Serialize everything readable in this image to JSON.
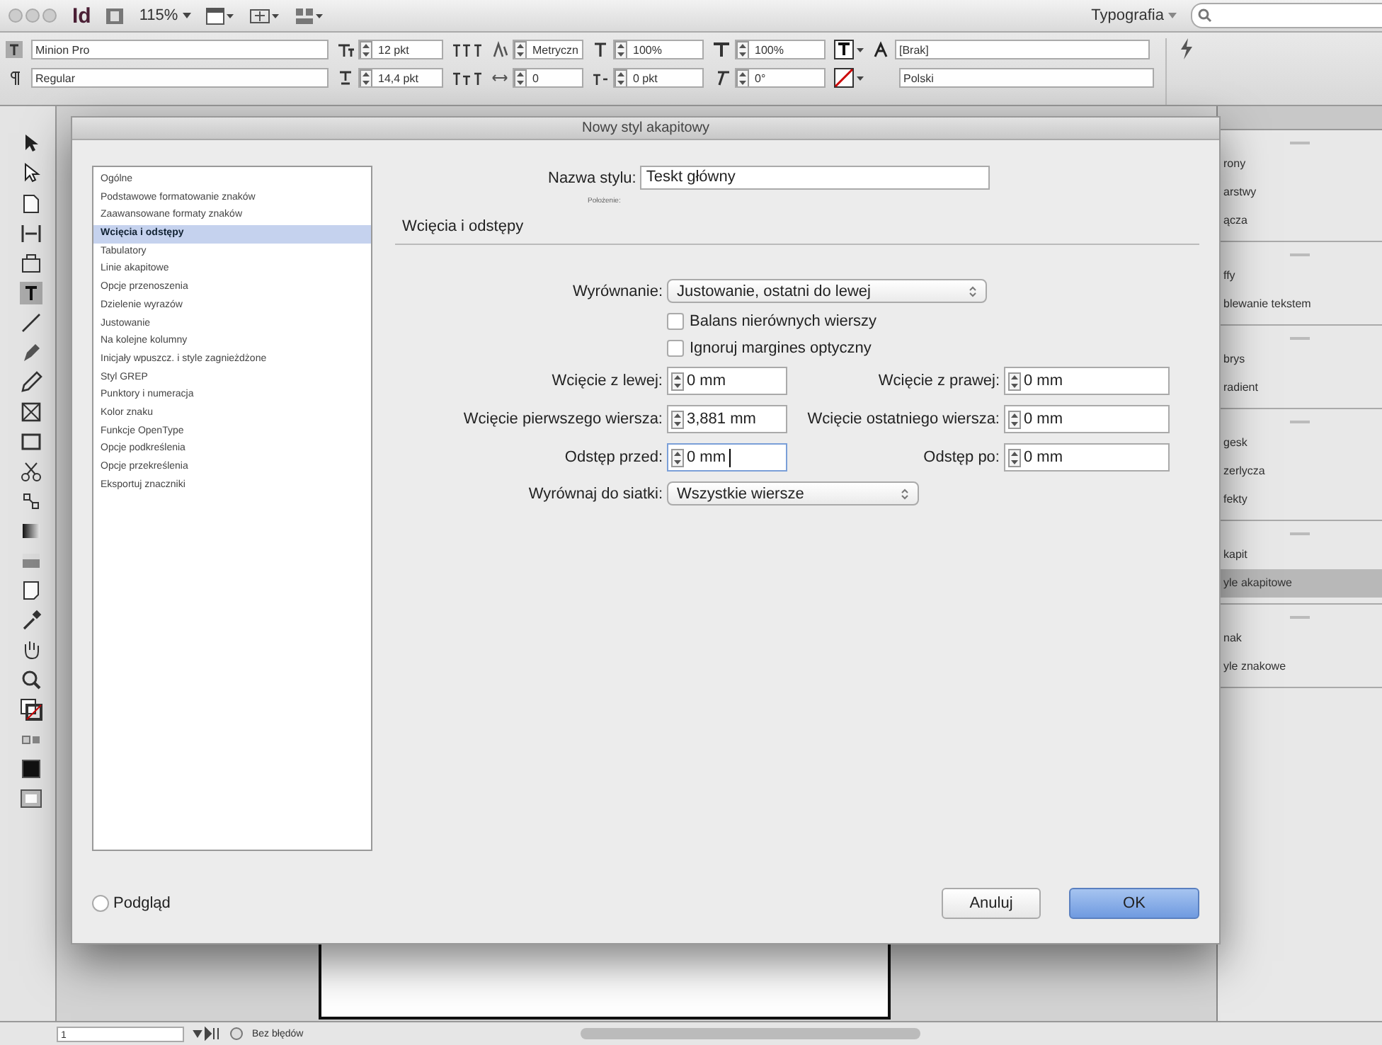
{
  "app_bar": {
    "logo": "Id",
    "zoom": "115%",
    "workspace": "Typografia"
  },
  "control_panel": {
    "font_family": "Minion Pro",
    "font_style": "Regular",
    "font_size": "12 pkt",
    "leading": "14,4 pkt",
    "kerning": "Metryczn",
    "tracking": "0",
    "vertical_scale": "100%",
    "baseline_shift": "0 pkt",
    "horizontal_scale": "100%",
    "skew": "0°",
    "char_style": "[Brak]",
    "language": "Polski"
  },
  "dialog": {
    "title": "Nowy styl akapitowy",
    "categories": [
      {
        "label": "Ogólne",
        "selected": false
      },
      {
        "label": "Podstawowe formatowanie znaków",
        "selected": false
      },
      {
        "label": "Zaawansowane formaty znaków",
        "selected": false
      },
      {
        "label": "Wcięcia i odstępy",
        "selected": true
      },
      {
        "label": "Tabulatory",
        "selected": false
      },
      {
        "label": "Linie akapitowe",
        "selected": false
      },
      {
        "label": "Opcje przenoszenia",
        "selected": false
      },
      {
        "label": "Dzielenie wyrazów",
        "selected": false
      },
      {
        "label": "Justowanie",
        "selected": false
      },
      {
        "label": "Na kolejne kolumny",
        "selected": false
      },
      {
        "label": "Inicjały wpuszcz. i style zagnieżdżone",
        "selected": false
      },
      {
        "label": "Styl GREP",
        "selected": false
      },
      {
        "label": "Punktory i numeracja",
        "selected": false
      },
      {
        "label": "Kolor znaku",
        "selected": false
      },
      {
        "label": "Funkcje OpenType",
        "selected": false
      },
      {
        "label": "Opcje podkreślenia",
        "selected": false
      },
      {
        "label": "Opcje przekreślenia",
        "selected": false
      },
      {
        "label": "Eksportuj znaczniki",
        "selected": false
      }
    ],
    "style_name_label": "Nazwa stylu:",
    "style_name": "Teskt główny",
    "location_label": "Położenie:",
    "section_title": "Wcięcia i odstępy",
    "alignment": {
      "label": "Wyrównanie:",
      "value": "Justowanie, ostatni do lewej"
    },
    "options": [
      {
        "label": "Balans nierównych wierszy",
        "checked": false
      },
      {
        "label": "Ignoruj margines optyczny",
        "checked": false
      }
    ],
    "field_rows": [
      [
        {
          "label": "Wcięcie z lewej:",
          "value": "0 mm",
          "focused": false
        },
        {
          "label": "Wcięcie z prawej:",
          "value": "0 mm",
          "focused": false
        }
      ],
      [
        {
          "label": "Wcięcie pierwszego wiersza:",
          "value": "3,881 mm",
          "focused": false
        },
        {
          "label": "Wcięcie ostatniego wiersza:",
          "value": "0 mm",
          "focused": false
        }
      ],
      [
        {
          "label": "Odstęp przed:",
          "value": "0 mm",
          "focused": true
        },
        {
          "label": "Odstęp po:",
          "value": "0 mm",
          "focused": false
        }
      ]
    ],
    "grid_alignment": {
      "label": "Wyrównaj do siatki:",
      "value": "Wszystkie wiersze"
    },
    "preview": {
      "label": "Podgląd",
      "checked": false
    },
    "buttons": [
      {
        "label": "Anuluj",
        "kind": "secondary"
      },
      {
        "label": "OK",
        "kind": "primary"
      }
    ]
  },
  "panel_groups": [
    [
      {
        "label": "rony",
        "selected": false
      },
      {
        "label": "arstwy",
        "selected": false
      },
      {
        "label": "ącza",
        "selected": false
      }
    ],
    [
      {
        "label": "ffy",
        "selected": false
      },
      {
        "label": "blewanie tekstem",
        "selected": false
      }
    ],
    [
      {
        "label": "brys",
        "selected": false
      },
      {
        "label": "radient",
        "selected": false
      }
    ],
    [
      {
        "label": "gesk",
        "selected": false
      },
      {
        "label": "zerlycza",
        "selected": false
      },
      {
        "label": "fekty",
        "selected": false
      }
    ],
    [
      {
        "label": "kapit",
        "selected": false
      },
      {
        "label": "yle akapitowe",
        "selected": true
      }
    ],
    [
      {
        "label": "nak",
        "selected": false
      },
      {
        "label": "yle znakowe",
        "selected": false
      }
    ]
  ],
  "status_bar": {
    "page": "1",
    "preflight": "Bez błędów"
  }
}
